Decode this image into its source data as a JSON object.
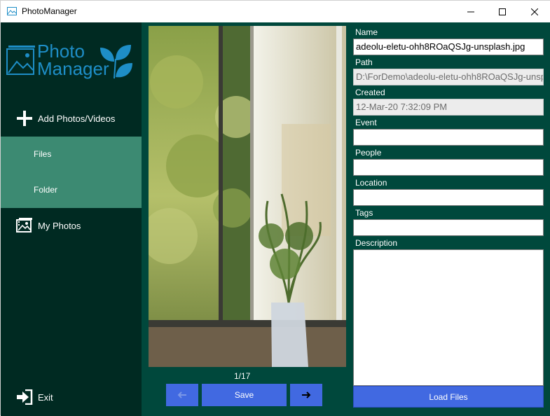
{
  "window": {
    "title": "PhotoManager"
  },
  "logo": {
    "line1": "Photo",
    "line2": "Manager"
  },
  "sidebar": {
    "add_label": "Add Photos/Videos",
    "files_label": "Files",
    "folder_label": "Folder",
    "myphotos_label": "My Photos",
    "exit_label": "Exit"
  },
  "viewer": {
    "counter": "1/17",
    "save_label": "Save"
  },
  "form": {
    "name_label": "Name",
    "name_value": "adeolu-eletu-ohh8ROaQSJg-unsplash.jpg",
    "path_label": "Path",
    "path_value": "D:\\ForDemo\\adeolu-eletu-ohh8ROaQSJg-unspl",
    "created_label": "Created",
    "created_value": "12-Mar-20 7:32:09 PM",
    "event_label": "Event",
    "event_value": "",
    "people_label": "People",
    "people_value": "",
    "location_label": "Location",
    "location_value": "",
    "tags_label": "Tags",
    "tags_value": "",
    "description_label": "Description",
    "description_value": "",
    "load_label": "Load Files"
  },
  "colors": {
    "sidebar_bg": "#002a22",
    "content_bg": "#00483c",
    "selected_bg": "#3c8a72",
    "accent_button": "#4169e1",
    "logo_blue": "#1e8ec7"
  }
}
